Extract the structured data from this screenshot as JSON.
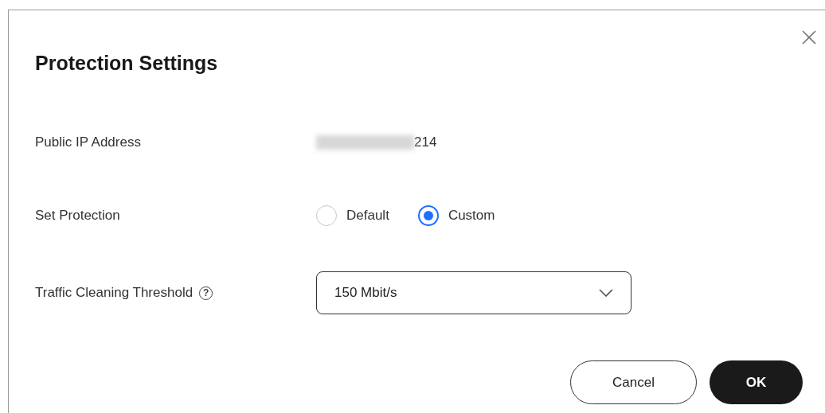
{
  "dialog": {
    "title": "Protection Settings",
    "fields": [
      {
        "kind": "text",
        "label": "Public IP Address",
        "value": "214"
      },
      {
        "kind": "radio",
        "label": "Set Protection",
        "options": [
          {
            "label": "Default",
            "selected": false
          },
          {
            "label": "Custom",
            "selected": true
          }
        ]
      },
      {
        "kind": "select",
        "label": "Traffic Cleaning Threshold",
        "help": "?",
        "value": "150 Mbit/s"
      }
    ],
    "buttons": [
      {
        "label": "Cancel",
        "kind": "secondary"
      },
      {
        "label": "OK",
        "kind": "primary"
      }
    ]
  }
}
